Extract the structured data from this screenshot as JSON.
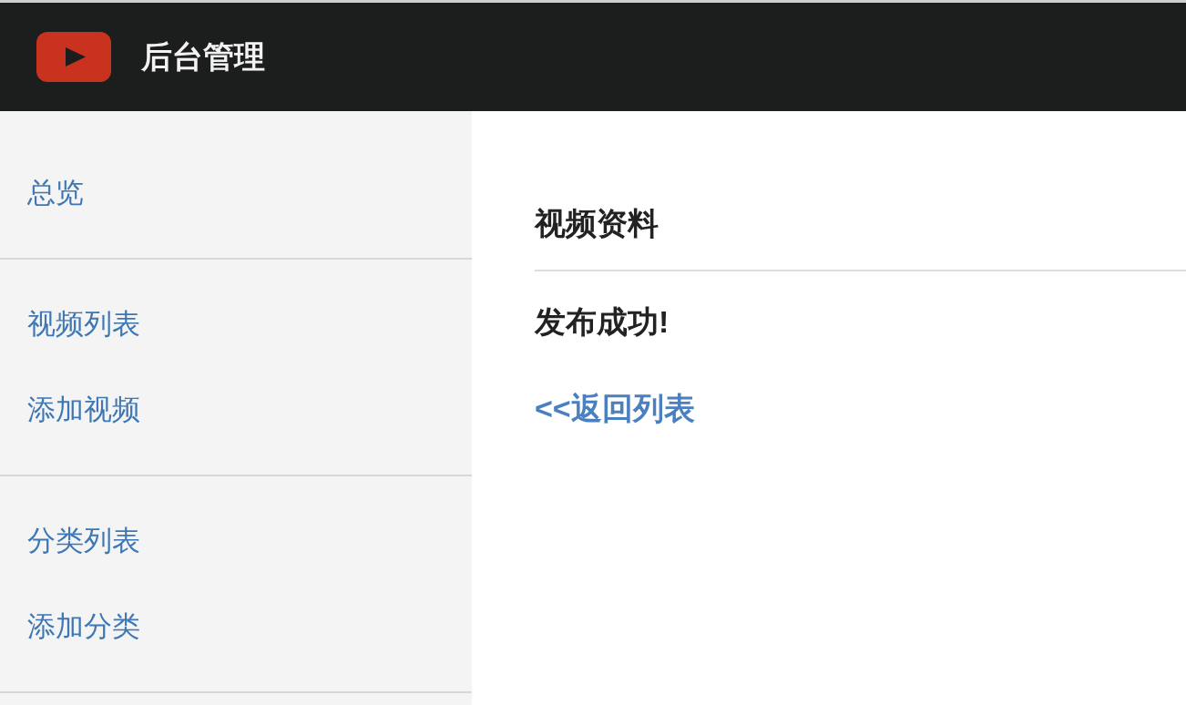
{
  "header": {
    "title": "后台管理"
  },
  "sidebar": {
    "groups": [
      {
        "items": [
          {
            "label": "总览"
          }
        ]
      },
      {
        "items": [
          {
            "label": "视频列表"
          },
          {
            "label": "添加视频"
          }
        ]
      },
      {
        "items": [
          {
            "label": "分类列表"
          },
          {
            "label": "添加分类"
          }
        ]
      }
    ]
  },
  "main": {
    "heading": "视频资料",
    "message": "发布成功!",
    "link": "<<返回列表"
  }
}
